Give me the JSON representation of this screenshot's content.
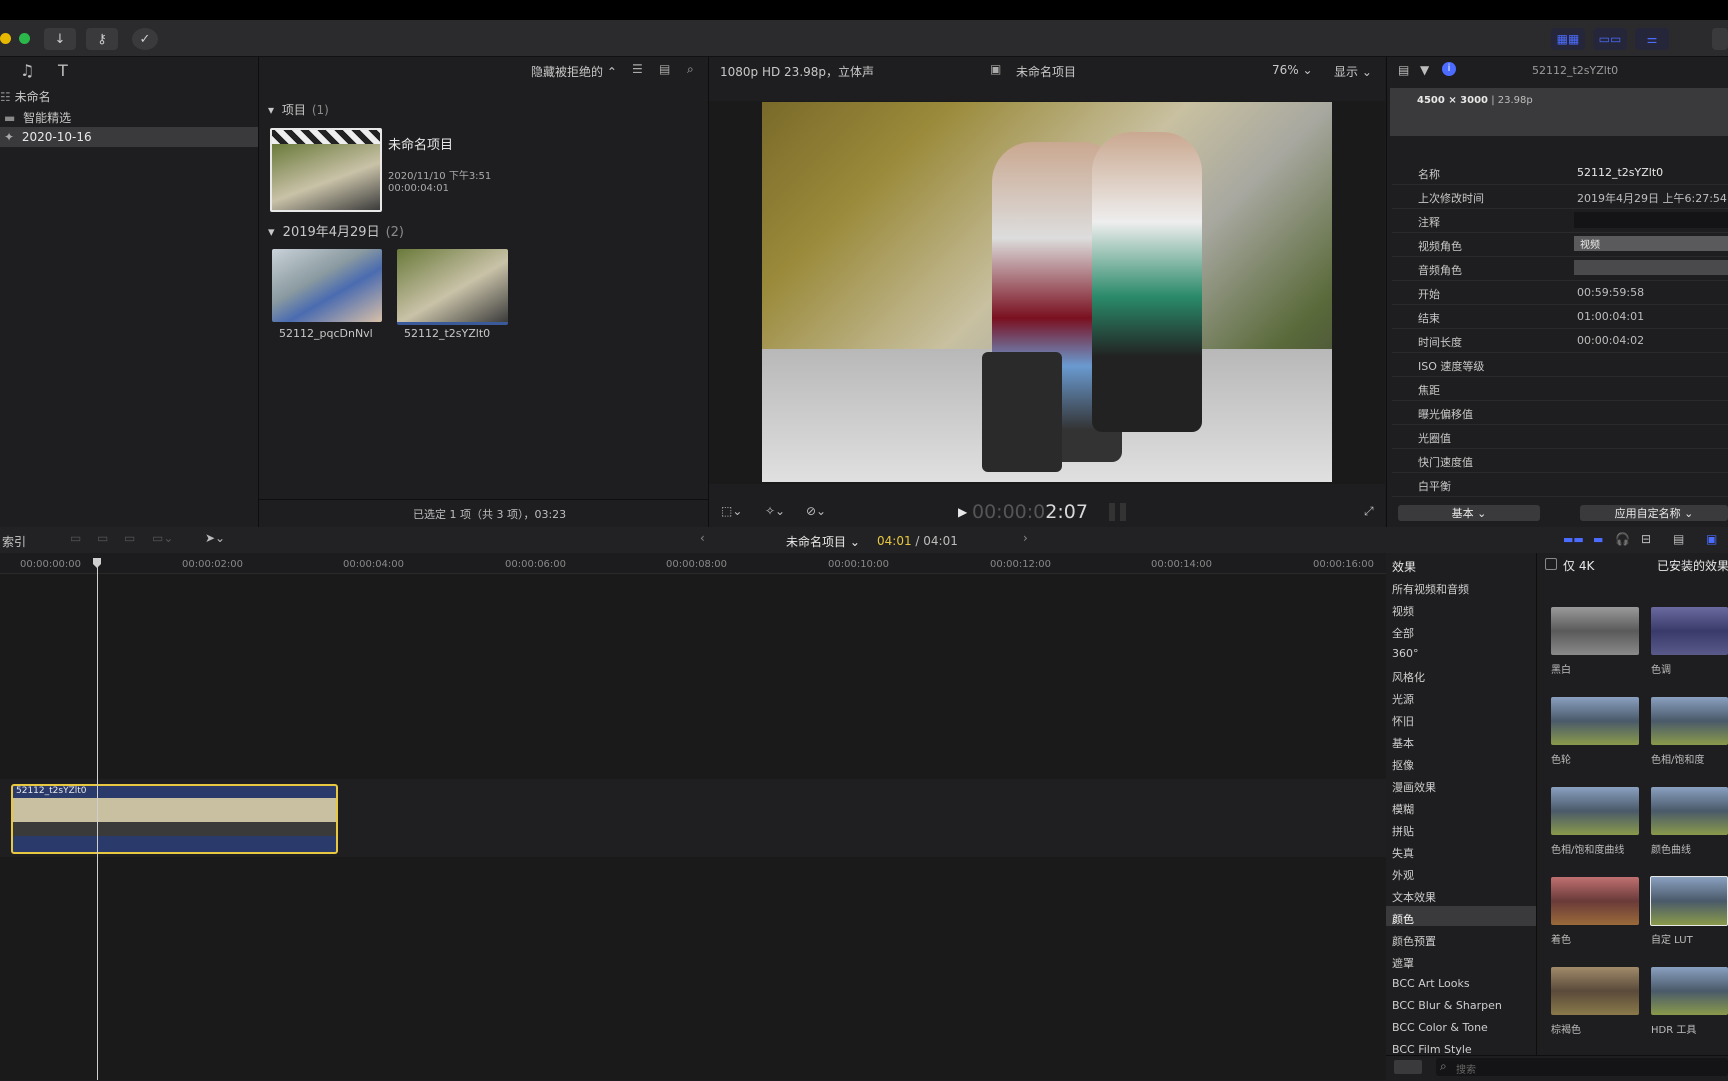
{
  "toolbar": {
    "btn_import": "↓",
    "btn_keywords": "⚷",
    "btn_check": "✓"
  },
  "library": {
    "items": [
      {
        "label": "未命名"
      },
      {
        "label": "智能精选"
      },
      {
        "label": "2020-10-16"
      }
    ]
  },
  "browser": {
    "filter": "隐藏被拒绝的",
    "group_projects": "项目",
    "group_projects_count": "(1)",
    "project_title": "未命名项目",
    "project_date": "2020/11/10 下午3:51",
    "project_duration": "00:00:04:01",
    "group_date": "2019年4月29日",
    "group_date_count": "(2)",
    "clips": [
      {
        "name": "52112_pqcDnNvl"
      },
      {
        "name": "52112_t2sYZlt0"
      }
    ],
    "status": "已选定 1 项（共 3 项），03:23"
  },
  "viewer": {
    "format": "1080p HD 23.98p，立体声",
    "project_name": "未命名项目",
    "zoom": "76%",
    "display": "显示",
    "timecode_dim": "00:00:0",
    "timecode": "2:07"
  },
  "inspector": {
    "clip_name": "52112_t2sYZlt0",
    "resolution": "4500 × 3000",
    "fps": "| 23.98p",
    "rows": [
      {
        "label": "名称",
        "value": "52112_t2sYZlt0"
      },
      {
        "label": "上次修改时间",
        "value": "2019年4月29日 上午6:27:54"
      },
      {
        "label": "注释",
        "value": ""
      },
      {
        "label": "视频角色",
        "value": "视频"
      },
      {
        "label": "音频角色",
        "value": ""
      },
      {
        "label": "开始",
        "value": "00:59:59:58"
      },
      {
        "label": "结束",
        "value": "01:00:04:01"
      },
      {
        "label": "时间长度",
        "value": "00:00:04:02"
      },
      {
        "label": "ISO 速度等级",
        "value": ""
      },
      {
        "label": "焦距",
        "value": ""
      },
      {
        "label": "曝光偏移值",
        "value": ""
      },
      {
        "label": "光圈值",
        "value": ""
      },
      {
        "label": "快门速度值",
        "value": ""
      },
      {
        "label": "白平衡",
        "value": ""
      }
    ],
    "metadata_view": "基本",
    "apply_name": "应用自定名称"
  },
  "timeline": {
    "index": "索引",
    "project": "未命名项目",
    "position": "04:01",
    "total": "/ 04:01",
    "ruler": [
      "00:00:00:00",
      "00:00:02:00",
      "00:00:04:00",
      "00:00:06:00",
      "00:00:08:00",
      "00:00:10:00",
      "00:00:12:00",
      "00:00:14:00",
      "00:00:16:00"
    ],
    "clip_name": "52112_t2sYZlt0"
  },
  "effects": {
    "title": "效果",
    "only4k": "仅 4K",
    "installed": "已安装的效果",
    "categories": [
      "所有视频和音频",
      "视频",
      "全部",
      "360°",
      "风格化",
      "光源",
      "怀旧",
      "基本",
      "抠像",
      "漫画效果",
      "模糊",
      "拼贴",
      "失真",
      "外观",
      "文本效果",
      "颜色",
      "颜色预置",
      "遮罩",
      "BCC Art Looks",
      "BCC Blur & Sharpen",
      "BCC Color & Tone",
      "BCC Film Style"
    ],
    "selected_category": "颜色",
    "tiles": [
      {
        "label": "黑白"
      },
      {
        "label": "色调"
      },
      {
        "label": "色轮"
      },
      {
        "label": "色相/饱和度"
      },
      {
        "label": "色相/饱和度曲线"
      },
      {
        "label": "颜色曲线"
      },
      {
        "label": "着色"
      },
      {
        "label": "自定 LUT"
      },
      {
        "label": "棕褐色"
      },
      {
        "label": "HDR 工具"
      }
    ],
    "search_placeholder": "搜索"
  }
}
